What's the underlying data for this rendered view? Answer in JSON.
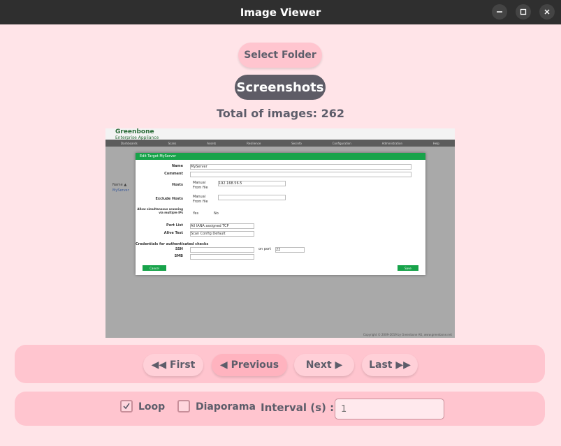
{
  "window": {
    "title": "Image Viewer",
    "controls": [
      "minimize-icon",
      "maximize-icon",
      "close-icon"
    ]
  },
  "header": {
    "select_folder_label": "Select Folder",
    "folder_name": "Screenshots",
    "total_text": "Total of images: 262"
  },
  "viewer": {
    "app_name": "Greenbone",
    "app_subtitle": "Enterprise Appliance",
    "nav_items": [
      "Dashboards",
      "Scans",
      "Assets",
      "Resilience",
      "Secinfo",
      "Configuration",
      "Administration",
      "Help"
    ],
    "side_labels": [
      "Name ▲",
      "MyServer"
    ],
    "dialog_title": "Edit Target MyServer",
    "fields": {
      "name_label": "Name",
      "name_value": "MyServer",
      "comment_label": "Comment",
      "hosts_label": "Hosts",
      "hosts_manual": "Manual",
      "hosts_value": "192.168.56.5",
      "hosts_from_file": "From file",
      "exclude_label": "Exclude Hosts",
      "allow_label": "Allow simultaneous scanning via multiple IPs",
      "allow_yes": "Yes",
      "allow_no": "No",
      "port_list_label": "Port List",
      "port_list_value": "All IANA assigned TCP",
      "alive_test_label": "Alive Test",
      "alive_test_value": "Scan Config Default",
      "credentials_heading": "Credentials for authenticated checks",
      "ssh_label": "SSH",
      "ssh_port_label": "on port",
      "ssh_port_value": "22",
      "smb_label": "SMB"
    },
    "cancel_label": "Cancel",
    "save_label": "Save",
    "footer": "Copyright © 2009-2019 by Greenbone AG, www.greenbone.net"
  },
  "navigation": {
    "first_label": "◀◀ First",
    "previous_label": "◀ Previous",
    "next_label": "Next ▶",
    "last_label": "Last ▶▶"
  },
  "controls": {
    "loop_label": "Loop",
    "loop_checked": true,
    "diaporama_label": "Diaporama",
    "diaporama_checked": false,
    "interval_label": "Interval (s) :",
    "interval_placeholder": "1"
  },
  "colors": {
    "background": "#ffe4e8",
    "panel": "#ffc5cf",
    "folder_pill": "#5e5c66",
    "text": "#5d5d6a",
    "titlebar": "#2f2f2f"
  }
}
